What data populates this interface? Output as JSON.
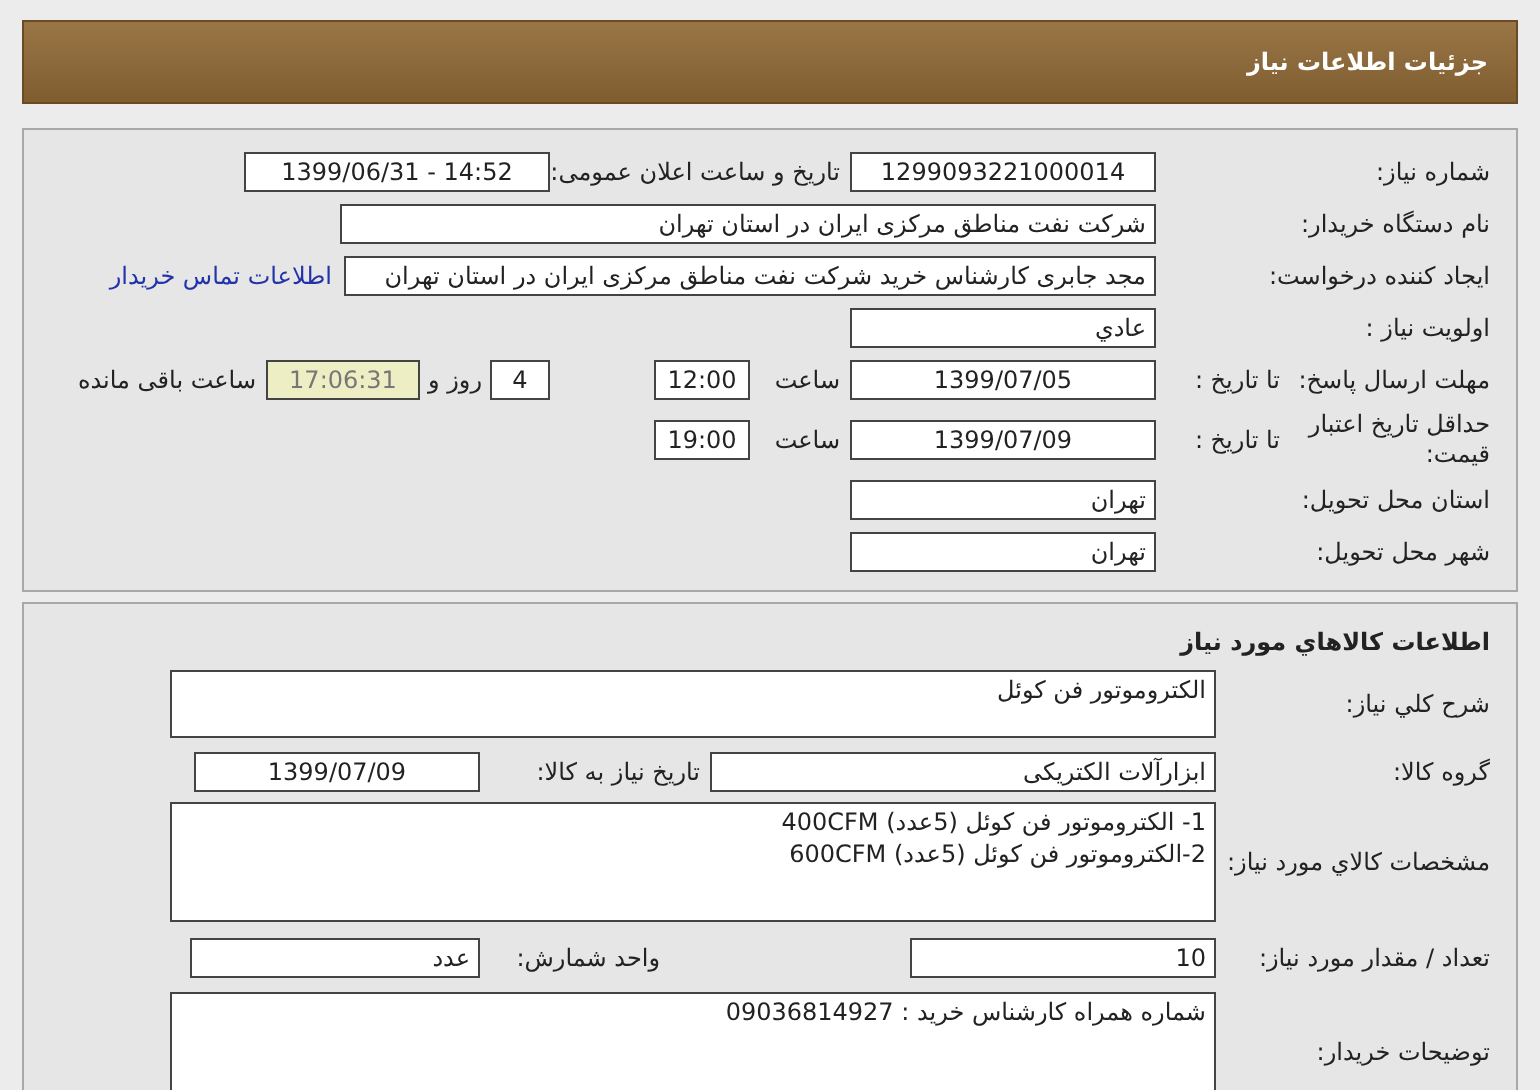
{
  "header_title": "جزئیات اطلاعات نیاز",
  "general": {
    "need_number_label": "شماره نیاز:",
    "need_number": "1299093221000014",
    "announce_label": "تاریخ و ساعت اعلان عمومی:",
    "announce_datetime": "1399/06/31 - 14:52",
    "buyer_label": "نام دستگاه خریدار:",
    "buyer": "شرکت نفت مناطق مرکزی ایران در استان تهران",
    "creator_label": "ایجاد کننده درخواست:",
    "creator": "مجد جابری کارشناس خرید شرکت نفت مناطق مرکزی ایران در استان تهران",
    "contact_link": "اطلاعات تماس خریدار",
    "priority_label": "اولویت نیاز :",
    "priority": "عادي",
    "deadline": {
      "label": "مهلت ارسال پاسخ:",
      "to_date_label": "تا تاریخ :",
      "date": "1399/07/05",
      "time_label": "ساعت",
      "time": "12:00",
      "days": "4",
      "days_label": "روز و",
      "remaining": "17:06:31",
      "remaining_label": "ساعت باقی مانده"
    },
    "validity": {
      "label": "حداقل تاریخ اعتبار قیمت:",
      "to_date_label": "تا تاریخ :",
      "date": "1399/07/09",
      "time_label": "ساعت",
      "time": "19:00"
    },
    "province_label": "استان محل تحویل:",
    "province": "تهران",
    "city_label": "شهر محل تحویل:",
    "city": "تهران"
  },
  "goods": {
    "title": "اطلاعات کالاهاي مورد نياز",
    "description_label": "شرح کلي نياز:",
    "description": "الکتروموتور فن کوئل",
    "group_label": "گروه کالا:",
    "group": "ابزارآلات الکتریکی",
    "need_date_label": "تاريخ نياز به کالا:",
    "need_date": "1399/07/09",
    "specs_label": "مشخصات کالاي مورد نياز:",
    "specs": [
      "1- الکتروموتور فن کوئل (5عدد) 400CFM",
      "2-الکتروموتور فن کوئل (5عدد) 600CFM"
    ],
    "quantity_label": "تعداد / مقدار مورد نياز:",
    "quantity": "10",
    "unit_label": "واحد شمارش:",
    "unit": "عدد",
    "notes_label": "توضيحات خريدار:",
    "notes": "شماره همراه کارشناس خرید : 09036814927"
  }
}
